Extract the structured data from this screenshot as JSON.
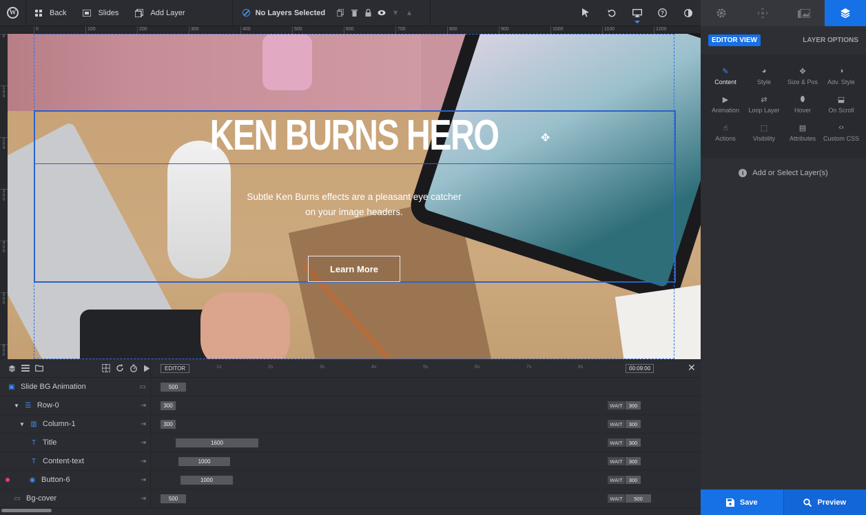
{
  "topbar": {
    "back_label": "Back",
    "slides_label": "Slides",
    "add_layer_label": "Add Layer",
    "layer_status": "No Layers Selected"
  },
  "ruler": {
    "top_ticks": [
      "0",
      "100",
      "200",
      "300",
      "400",
      "500",
      "600",
      "700",
      "800",
      "900",
      "1000",
      "1100",
      "1200"
    ],
    "left_ticks": [
      "0",
      "100",
      "200",
      "300",
      "400",
      "500",
      "600"
    ]
  },
  "slide": {
    "title": "KEN BURNS HERO",
    "subtitle_line1": "Subtle Ken Burns effects are a pleasant eye catcher",
    "subtitle_line2": "on your image headers.",
    "button_label": "Learn More"
  },
  "right_panel": {
    "editor_view_label": "EDITOR VIEW",
    "layer_options_label": "LAYER OPTIONS",
    "options": [
      {
        "label": "Content",
        "icon": "pencil-icon",
        "active": true
      },
      {
        "label": "Style",
        "icon": "palette-icon"
      },
      {
        "label": "Size & Pos",
        "icon": "move-icon"
      },
      {
        "label": "Adv. Style",
        "icon": "contrast-icon"
      },
      {
        "label": "Animation",
        "icon": "play-icon"
      },
      {
        "label": "Loop Layer",
        "icon": "loop-icon"
      },
      {
        "label": "Hover",
        "icon": "mouse-icon"
      },
      {
        "label": "On Scroll",
        "icon": "scroll-icon"
      },
      {
        "label": "Actions",
        "icon": "hand-icon"
      },
      {
        "label": "Visibility",
        "icon": "visibility-icon"
      },
      {
        "label": "Attributes",
        "icon": "file-icon"
      },
      {
        "label": "Custom CSS",
        "icon": "code-icon"
      }
    ],
    "add_select_label": "Add or Select Layer(s)",
    "save_label": "Save",
    "preview_label": "Preview"
  },
  "timeline": {
    "editor_label": "EDITOR",
    "time_marks": [
      "1s",
      "2s",
      "3s",
      "4s",
      "5s",
      "6s",
      "7s",
      "8s",
      "1("
    ],
    "current_time": "00:09:00",
    "wait_label": "WAIT",
    "rows": [
      {
        "name": "Slide BG Animation",
        "bar": "500"
      },
      {
        "name": "Row-0",
        "bar": "300",
        "wait": "300"
      },
      {
        "name": "Column-1",
        "bar": "300",
        "wait": "300"
      },
      {
        "name": "Title",
        "bar": "1600",
        "wait": "300"
      },
      {
        "name": "Content-text",
        "bar": "1000",
        "wait": "300"
      },
      {
        "name": "Button-6",
        "bar": "1000",
        "wait": "300"
      },
      {
        "name": "Bg-cover",
        "bar": "500",
        "wait": "500"
      }
    ]
  },
  "colors": {
    "accent": "#1670e6",
    "selection": "#2a62c9",
    "marker": "#e0407b"
  }
}
